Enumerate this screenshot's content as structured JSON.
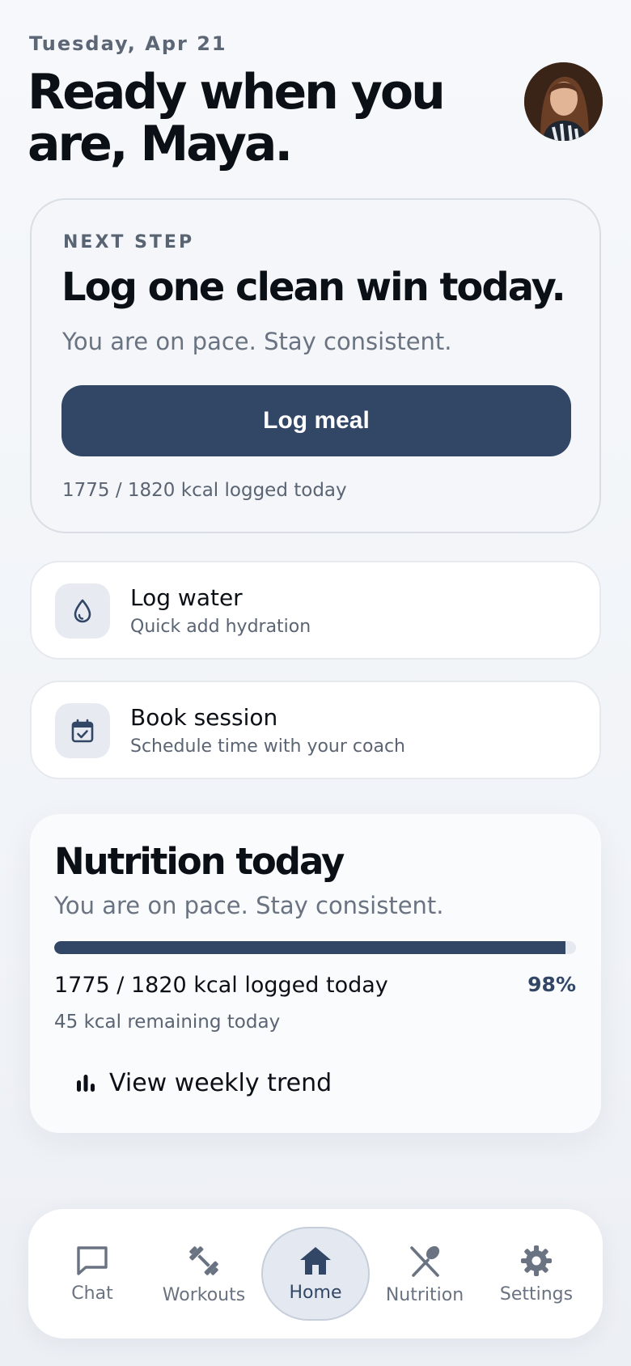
{
  "header": {
    "date": "Tuesday, Apr 21",
    "greeting": "Ready when you are, Maya."
  },
  "next_step": {
    "eyebrow": "NEXT STEP",
    "title": "Log one clean win today.",
    "subtitle": "You are on pace. Stay consistent.",
    "button_label": "Log meal",
    "kcal_summary": "1775 / 1820 kcal logged today"
  },
  "actions": [
    {
      "title": "Log water",
      "subtitle": "Quick add hydration",
      "icon": "water-drop-icon"
    },
    {
      "title": "Book session",
      "subtitle": "Schedule time with your coach",
      "icon": "calendar-check-icon"
    }
  ],
  "nutrition": {
    "title": "Nutrition today",
    "subtitle": "You are on pace. Stay consistent.",
    "logged_kcal": 1775,
    "goal_kcal": 1820,
    "progress_fraction": 0.98,
    "kcal_summary": "1775 / 1820 kcal logged today",
    "percent_label": "98%",
    "remaining": "45 kcal remaining today",
    "trend_link": "View weekly trend"
  },
  "tabs": [
    {
      "label": "Chat",
      "icon": "chat-bubble-icon",
      "active": false
    },
    {
      "label": "Workouts",
      "icon": "dumbbell-icon",
      "active": false
    },
    {
      "label": "Home",
      "icon": "home-icon",
      "active": true
    },
    {
      "label": "Nutrition",
      "icon": "fork-spoon-icon",
      "active": false
    },
    {
      "label": "Settings",
      "icon": "gear-icon",
      "active": false
    }
  ],
  "colors": {
    "accent": "#324666",
    "muted_text": "#6a7381",
    "card_bg": "#ffffff",
    "page_bg": "#f2f5f9"
  }
}
